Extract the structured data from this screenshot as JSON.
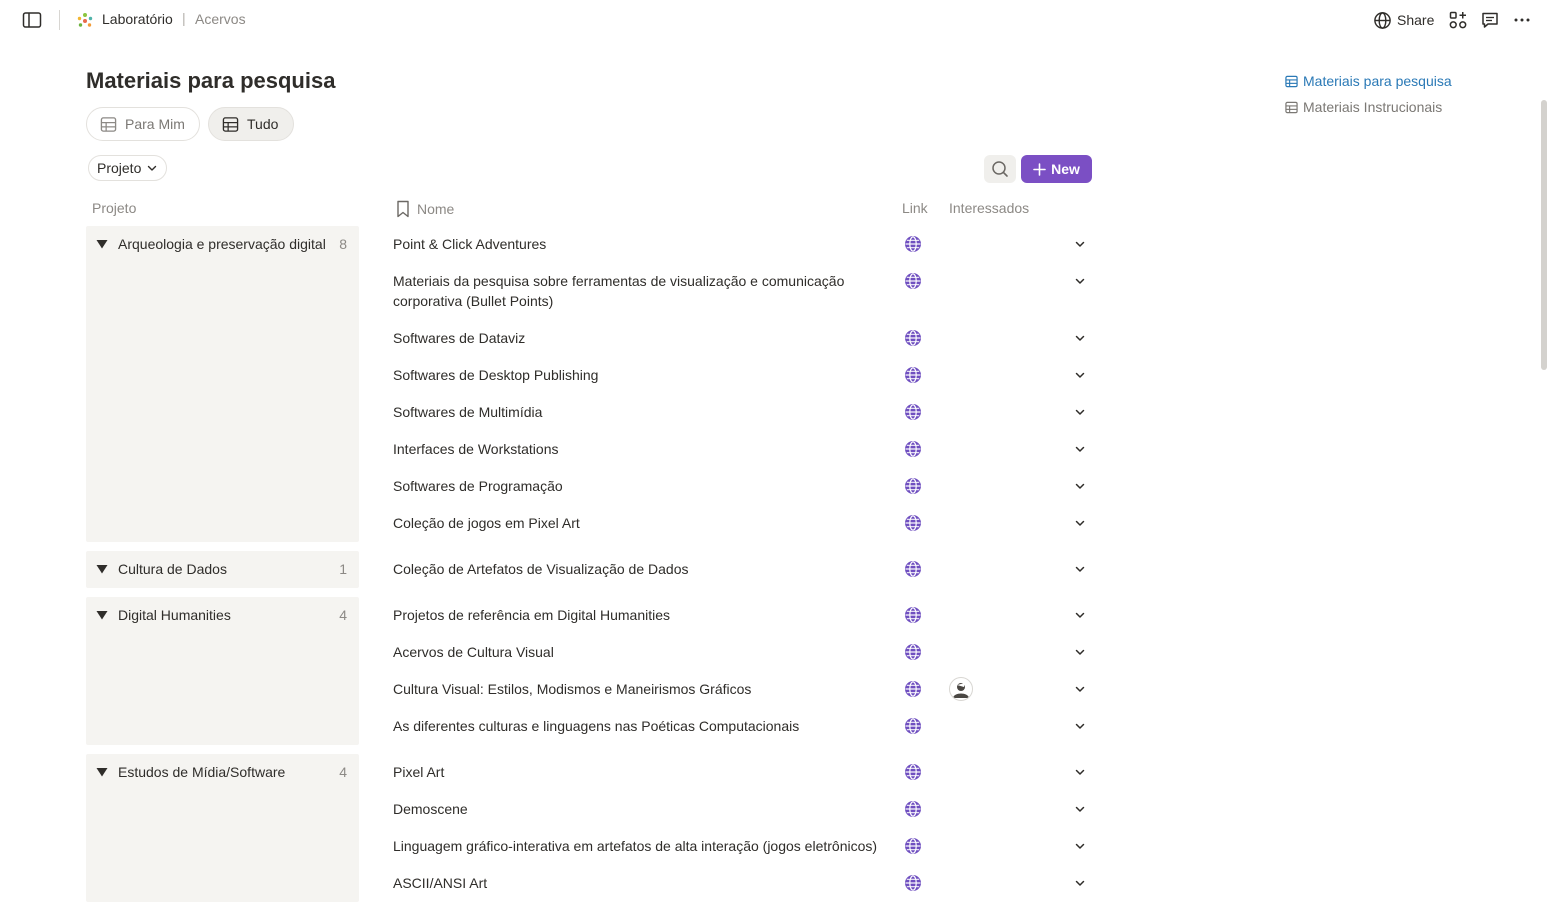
{
  "topbar": {
    "breadcrumb_workspace": "Laboratório",
    "breadcrumb_separator": "|",
    "breadcrumb_page": "Acervos",
    "share_label": "Share",
    "icons": [
      "sidebar-toggle-icon",
      "globe-icon",
      "apps-icon",
      "comment-icon",
      "more-icon"
    ]
  },
  "toc": {
    "items": [
      {
        "label": "Materiais para pesquisa",
        "active": true
      },
      {
        "label": "Materiais Instrucionais",
        "active": false
      }
    ]
  },
  "page": {
    "title": "Materiais para pesquisa",
    "views": [
      {
        "label": "Para Mim",
        "active": false
      },
      {
        "label": "Tudo",
        "active": true
      }
    ],
    "filter_label": "Projeto",
    "new_label": "New"
  },
  "table": {
    "columns": {
      "group": "Projeto",
      "name": "Nome",
      "link": "Link",
      "interested": "Interessados"
    },
    "groups": [
      {
        "name": "Arqueologia e preservação digital",
        "count": "8",
        "rows": [
          {
            "name": "Point & Click Adventures"
          },
          {
            "name": "Materiais da pesquisa sobre ferramentas de visualização e comunicação corporativa (Bullet Points)"
          },
          {
            "name": "Softwares de Dataviz"
          },
          {
            "name": "Softwares de Desktop Publishing"
          },
          {
            "name": "Softwares de Multimídia"
          },
          {
            "name": "Interfaces de Workstations"
          },
          {
            "name": "Softwares de Programação"
          },
          {
            "name": "Coleção de jogos em Pixel Art"
          }
        ]
      },
      {
        "name": "Cultura de Dados",
        "count": "1",
        "rows": [
          {
            "name": "Coleção de Artefatos de Visualização de Dados"
          }
        ]
      },
      {
        "name": "Digital Humanities",
        "count": "4",
        "rows": [
          {
            "name": "Projetos de referência em Digital Humanities"
          },
          {
            "name": "Acervos de Cultura Visual"
          },
          {
            "name": "Cultura Visual: Estilos, Modismos e Maneirismos Gráficos",
            "has_avatar": true
          },
          {
            "name": "As diferentes culturas e linguagens nas Poéticas Computacionais"
          }
        ]
      },
      {
        "name": "Estudos de Mídia/Software",
        "count": "4",
        "rows": [
          {
            "name": "Pixel Art"
          },
          {
            "name": "Demoscene"
          },
          {
            "name": "Linguagem gráfico-interativa em artefatos de alta interação (jogos eletrônicos)"
          },
          {
            "name": "ASCII/ANSI Art"
          }
        ]
      }
    ]
  },
  "colors": {
    "accent_purple": "#7b4fc4",
    "link_globe": "#6f4fc0",
    "toc_active": "#2a79b6",
    "group_bg": "#f5f4f1"
  }
}
